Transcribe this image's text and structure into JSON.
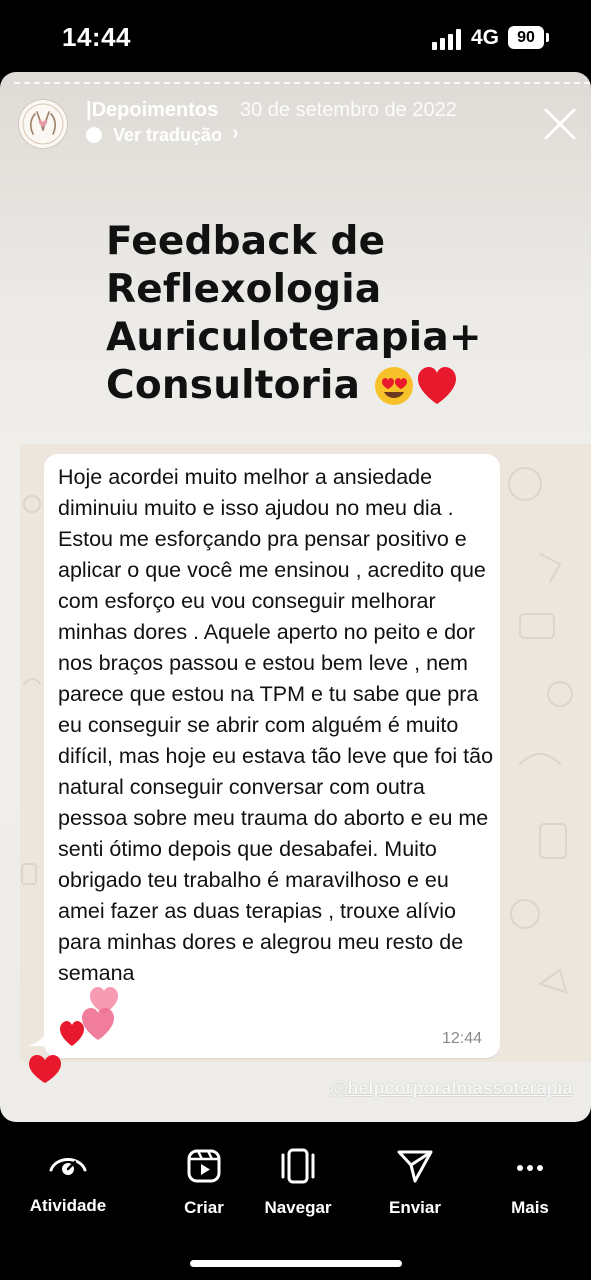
{
  "status_bar": {
    "time": "14:44",
    "network": "4G",
    "battery": "90"
  },
  "story_header": {
    "author": "|Depoimentos",
    "date": "30 de setembro de 2022",
    "translate_label": "Ver tradução"
  },
  "headline": {
    "line1": "Feedback de",
    "line2": "Reflexologia",
    "line3": "Auriculoterapia+",
    "line4": "Consultoria"
  },
  "message": {
    "text": "Hoje acordei muito melhor a ansiedade diminuiu muito e isso ajudou no meu dia . Estou me esforçando pra pensar positivo e aplicar o que você me ensinou , acredito que com esforço eu vou conseguir melhorar minhas dores . Aquele aperto no peito e dor nos braços passou e estou bem leve , nem parece que estou na TPM e tu sabe que pra eu conseguir se abrir com alguém é muito difícil, mas hoje eu estava tão leve que foi tão natural conseguir conversar com outra pessoa sobre meu trauma do aborto e eu me senti ótimo depois que desabafei. Muito obrigado teu trabalho é maravilhoso e eu amei fazer as duas terapias , trouxe alívio para minhas dores e alegrou meu resto de semana",
    "time": "12:44"
  },
  "watermark": "@helpcorporalmassoterapia",
  "bottom_nav": [
    {
      "label": "Atividade",
      "icon": "activity-eye-icon"
    },
    {
      "label": "Criar",
      "icon": "create-reel-icon"
    },
    {
      "label": "Navegar",
      "icon": "browse-carousel-icon"
    },
    {
      "label": "Enviar",
      "icon": "send-paper-plane-icon"
    },
    {
      "label": "Mais",
      "icon": "more-dots-icon"
    }
  ],
  "colors": {
    "background": "#000000",
    "heart_red": "#e8192c",
    "bubble": "#ffffff",
    "chat_background": "#ece6dd"
  }
}
